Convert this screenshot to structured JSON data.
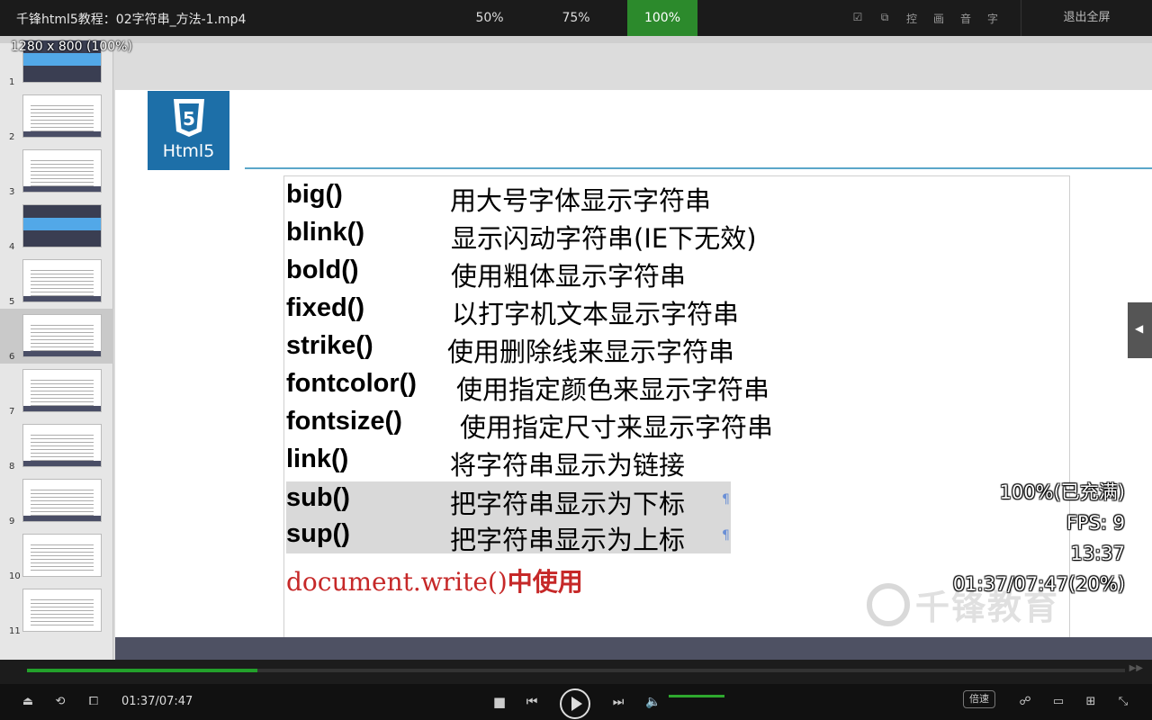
{
  "topbar": {
    "title": "千锋html5教程：02字符串_方法-1.mp4",
    "zoom_options": [
      {
        "label": "50%",
        "active": false
      },
      {
        "label": "75%",
        "active": false
      },
      {
        "label": "100%",
        "active": true
      }
    ],
    "tool_icons": [
      "☑",
      "⧉",
      "控",
      "画",
      "音",
      "字"
    ],
    "exit_label": "退出全屏"
  },
  "overlay": {
    "resolution": "1280 x 800 (100%)",
    "buffer": "100%(已充满)",
    "fps": "FPS: 9",
    "clock": "13:37",
    "position": "01:37/07:47(20%)"
  },
  "thumbnails": {
    "numbers": [
      "1",
      "2",
      "3",
      "4",
      "5",
      "6",
      "7",
      "8",
      "9",
      "10",
      "11"
    ],
    "selected_index": 6
  },
  "slide": {
    "logo_label": "Html5",
    "logo_number": "5",
    "methods": [
      {
        "method": "big()",
        "desc": "用大号字体显示字符串"
      },
      {
        "method": "blink()",
        "desc": "显示闪动字符串(IE下无效)"
      },
      {
        "method": "bold()",
        "desc": "使用粗体显示字符串"
      },
      {
        "method": "fixed()",
        "desc": "以打字机文本显示字符串"
      },
      {
        "method": "strike()",
        "desc": "使用删除线来显示字符串"
      },
      {
        "method": "fontcolor()",
        "desc": "使用指定颜色来显示字符串"
      },
      {
        "method": "fontsize()",
        "desc": "使用指定尺寸来显示字符串"
      },
      {
        "method": "link()",
        "desc": "将字符串显示为链接"
      },
      {
        "method": "sub()",
        "desc": "把字符串显示为下标"
      },
      {
        "method": "sup()",
        "desc": "把字符串显示为上标"
      }
    ],
    "footer_code": "document.write()",
    "footer_text": "中使用",
    "watermark": "千锋教育"
  },
  "player": {
    "time": "01:37/07:47",
    "progress": 0.2,
    "volume": 1.0,
    "speed_label": "倍速"
  },
  "colors": {
    "accent_green": "#23a12b",
    "html5_blue": "#1d6fa8",
    "highlight_red": "#c62828"
  }
}
